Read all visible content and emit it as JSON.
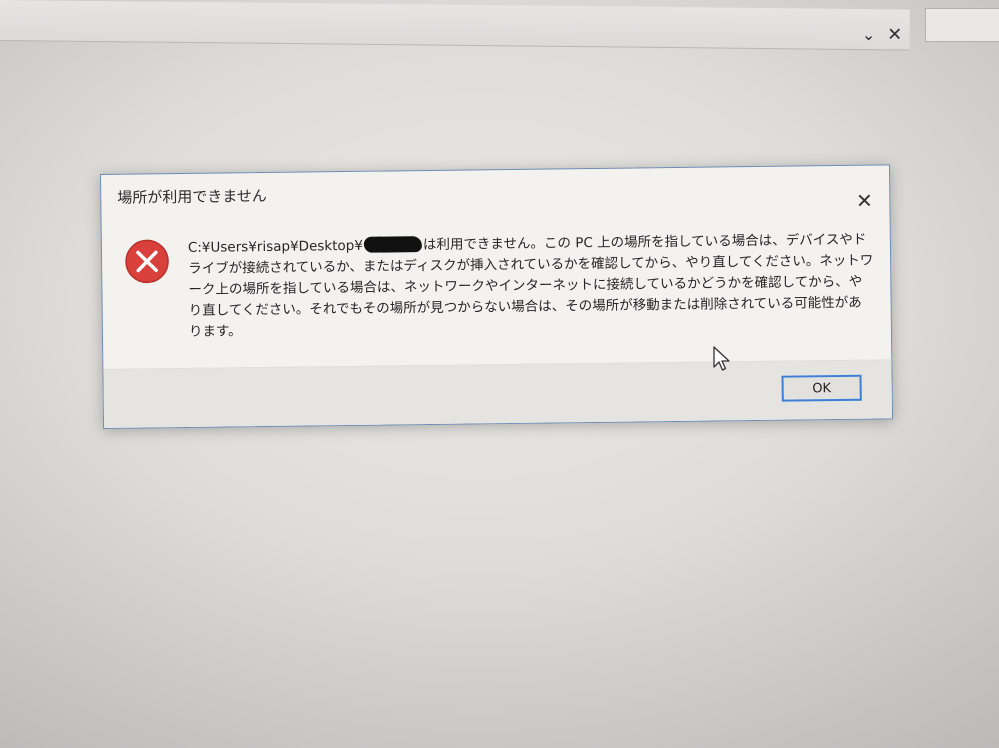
{
  "dialog": {
    "title": "場所が利用できません",
    "close_glyph": "✕",
    "message_prefix": "C:¥Users¥risap¥Desktop¥",
    "message_rest": "は利用できません。この PC 上の場所を指している場合は、デバイスやドライブが接続されているか、またはディスクが挿入されているかを確認してから、やり直してください。ネットワーク上の場所を指している場合は、ネットワークやインターネットに接続しているかどうかを確認してから、やり直してください。それでもその場所が見つからない場合は、その場所が移動または削除されている可能性があります。",
    "ok_label": "OK",
    "icon": "error-icon",
    "icon_color": "#d9403b"
  },
  "background_window": {
    "chevron_glyph": "⌄",
    "close_glyph": "✕"
  },
  "colors": {
    "accent": "#3c7fd6",
    "dialog_border": "#6d8bb5"
  }
}
